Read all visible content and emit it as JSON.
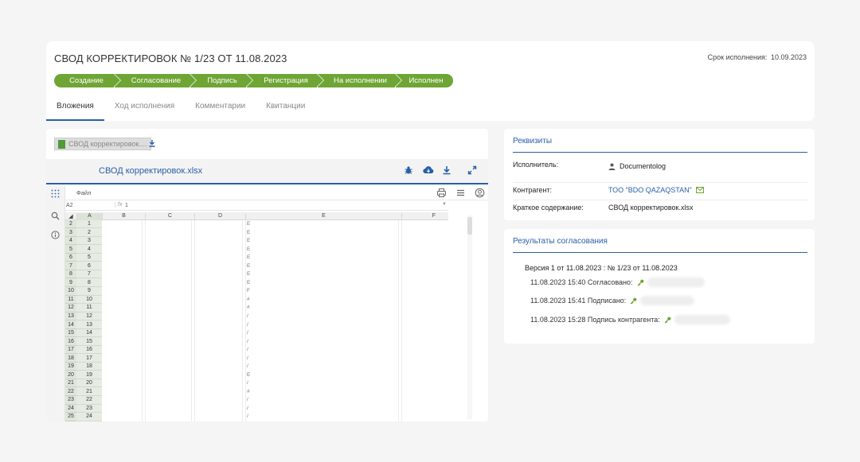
{
  "header": {
    "title": "СВОД КОРРЕКТИРОВОК № 1/23 ОТ 11.08.2023",
    "deadline_label": "Срок исполнения:",
    "deadline_value": "10.09.2023",
    "stages": [
      "Создание",
      "Согласование",
      "Подпись",
      "Регистрация",
      "На исполнении",
      "Исполнен"
    ],
    "stage_color": "#6fa534",
    "tabs": [
      {
        "label": "Вложения",
        "active": true
      },
      {
        "label": "Ход исполнения",
        "active": false
      },
      {
        "label": "Комментарии",
        "active": false
      },
      {
        "label": "Квитанции",
        "active": false
      }
    ]
  },
  "attachment": {
    "chip_label": "СВОД корректировок....",
    "file_name": "СВОД корректировок.xlsx",
    "icons": [
      "bug-icon",
      "cloud-download-icon",
      "download-icon",
      "expand-icon"
    ]
  },
  "spreadsheet": {
    "menu_file": "Файл",
    "cell_ref": "A2",
    "fx": "fx",
    "formula_value": "1",
    "columns": [
      "A",
      "B",
      "C",
      "D",
      "E",
      "F"
    ],
    "row_numbers": [
      "2",
      "3",
      "4",
      "5",
      "6",
      "7",
      "8",
      "9",
      "10",
      "11",
      "12",
      "13",
      "14",
      "15",
      "16",
      "17",
      "18",
      "19",
      "20",
      "21",
      "22",
      "23",
      "24",
      "25"
    ],
    "col_a_values": [
      "1",
      "2",
      "3",
      "4",
      "5",
      "6",
      "7",
      "8",
      "9",
      "10",
      "11",
      "12",
      "13",
      "14",
      "15",
      "16",
      "17",
      "18",
      "19",
      "20",
      "21",
      "22",
      "23",
      "24"
    ],
    "col_e_stubs": [
      "Е",
      "Е",
      "Е",
      "Е",
      "Е",
      "Е",
      "Е",
      "Е",
      "F",
      "#",
      "#",
      "/",
      "/",
      "/",
      "/",
      "/",
      "/",
      "/",
      "Е",
      "/",
      "#",
      "/",
      "/",
      "/"
    ],
    "accent_line_color": "#e07070"
  },
  "requisites": {
    "title": "Реквизиты",
    "rows": [
      {
        "label": "Исполнитель:",
        "value": "Documentolog"
      },
      {
        "label": "Контрагент:",
        "value": "ТОО \"BDO QAZAQSTAN\""
      },
      {
        "label": "Краткое содержание:",
        "value": "СВОД корректировок.xlsx"
      }
    ]
  },
  "results": {
    "title": "Результаты согласования",
    "version": "Версия 1 от 11.08.2023 : № 1/23 от 11.08.2023",
    "entries": [
      {
        "text": "11.08.2023 15:40 Согласовано:"
      },
      {
        "text": "11.08.2023 15:41 Подписано:"
      },
      {
        "text": "11.08.2023 15:28 Подпись контрагента:"
      }
    ]
  },
  "accent_color": "#2a5fa8"
}
